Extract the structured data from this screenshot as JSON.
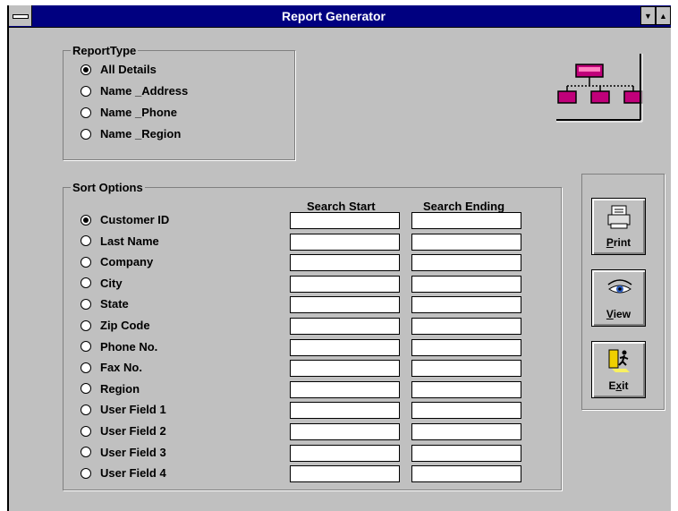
{
  "window": {
    "title": "Report Generator"
  },
  "report_type": {
    "legend": "ReportType",
    "options": [
      "All Details",
      "Name _Address",
      "Name _Phone",
      "Name _Region"
    ],
    "selected": "All Details"
  },
  "sort_options": {
    "legend": "Sort Options",
    "col_start": "Search Start",
    "col_end": "Search Ending",
    "options": [
      "Customer ID",
      "Last Name",
      "Company",
      "City",
      "State",
      "Zip Code",
      "Phone No.",
      "Fax No.",
      "Region",
      "User Field 1",
      "User Field 2",
      "User Field 3",
      "User Field 4"
    ],
    "selected": "Customer ID"
  },
  "buttons": {
    "print": {
      "hot": "P",
      "rest": "rint"
    },
    "view": {
      "hot": "V",
      "rest": "iew"
    },
    "exit": {
      "pre": "E",
      "hot": "x",
      "rest": "it"
    }
  },
  "icons": {
    "print": "printer-icon",
    "view": "eye-icon",
    "exit": "exit-door-icon",
    "logo": "org-chart-icon"
  },
  "colors": {
    "titlebar": "#000080",
    "face": "#c0c0c0",
    "accent": "#c0007a"
  }
}
